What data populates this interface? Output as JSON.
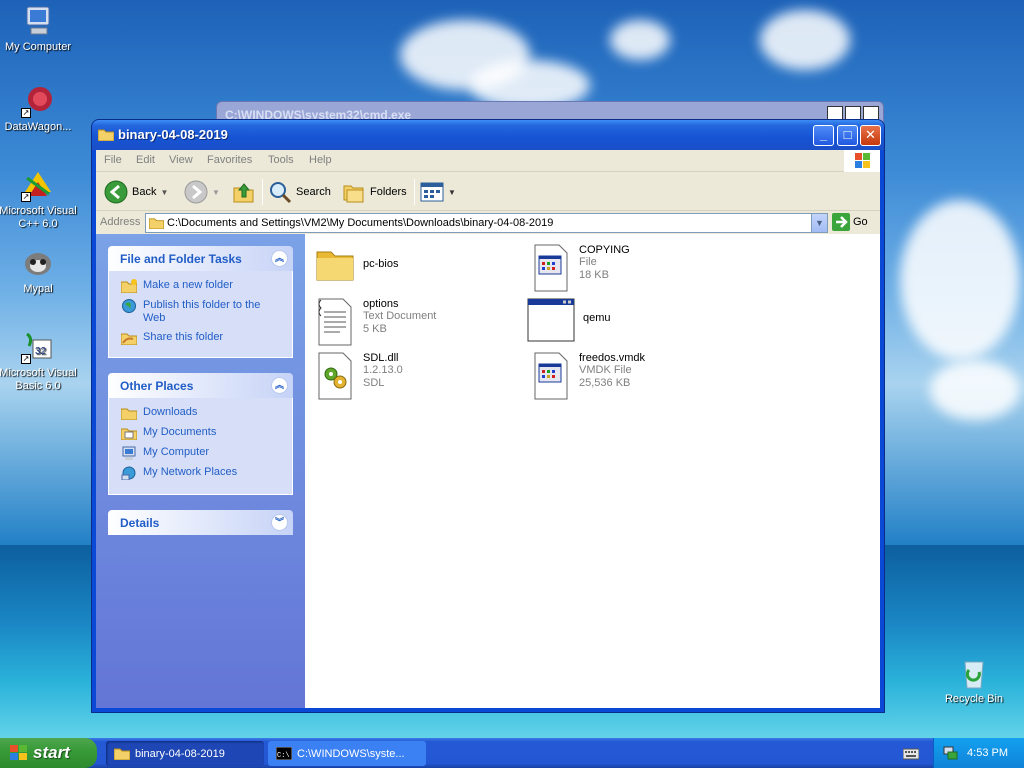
{
  "desktop": {
    "icons": [
      {
        "label": "My Computer"
      },
      {
        "label": "DataWagon..."
      },
      {
        "label": "Microsoft Visual C++ 6.0"
      },
      {
        "label": "Mypal"
      },
      {
        "label": "Microsoft Visual Basic 6.0"
      },
      {
        "label": "Recycle Bin"
      }
    ]
  },
  "cmd_window": {
    "title": "C:\\WINDOWS\\system32\\cmd.exe"
  },
  "window": {
    "title": "binary-04-08-2019",
    "menu": [
      "File",
      "Edit",
      "View",
      "Favorites",
      "Tools",
      "Help"
    ],
    "toolbar": {
      "back": "Back",
      "search": "Search",
      "folders": "Folders"
    },
    "address": {
      "label": "Address",
      "value": "C:\\Documents and Settings\\VM2\\My Documents\\Downloads\\binary-04-08-2019",
      "go": "Go"
    },
    "tasks": {
      "file_folder": {
        "title": "File and Folder Tasks",
        "items": [
          "Make a new folder",
          "Publish this folder to the Web",
          "Share this folder"
        ]
      },
      "other_places": {
        "title": "Other Places",
        "items": [
          "Downloads",
          "My Documents",
          "My Computer",
          "My Network Places"
        ]
      },
      "details": {
        "title": "Details"
      }
    },
    "files": [
      {
        "name": "pc-bios",
        "type": "",
        "size": ""
      },
      {
        "name": "COPYING",
        "type": "File",
        "size": "18 KB"
      },
      {
        "name": "options",
        "type": "Text Document",
        "size": "5 KB"
      },
      {
        "name": "qemu",
        "type": "",
        "size": ""
      },
      {
        "name": "SDL.dll",
        "type": "1.2.13.0",
        "size": "SDL"
      },
      {
        "name": "freedos.vmdk",
        "type": "VMDK File",
        "size": "25,536 KB"
      }
    ]
  },
  "taskbar": {
    "start": "start",
    "tasks": [
      "binary-04-08-2019",
      "C:\\WINDOWS\\syste..."
    ],
    "clock": "4:53 PM"
  },
  "colors": {
    "titlebar": "#1653d4",
    "taskpane_link": "#215dc6",
    "start_green": "#389b38"
  }
}
